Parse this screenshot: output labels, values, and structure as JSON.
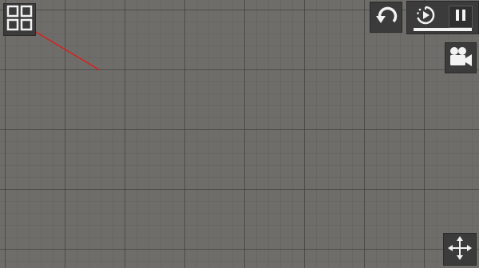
{
  "buttons": {
    "grid": {
      "icon": "grid-icon"
    },
    "undo": {
      "icon": "undo-icon"
    },
    "slowmo": {
      "icon": "slow-motion-icon"
    },
    "pause": {
      "icon": "pause-icon"
    },
    "camera": {
      "icon": "camera-icon"
    },
    "move": {
      "icon": "move-arrows-icon"
    }
  },
  "time_scale": {
    "fraction": 1.0
  },
  "colors": {
    "background": "#6f6d69",
    "panel": "#3b3b3b",
    "icon": "#f2f2f2",
    "drag_line": "#d62020"
  }
}
